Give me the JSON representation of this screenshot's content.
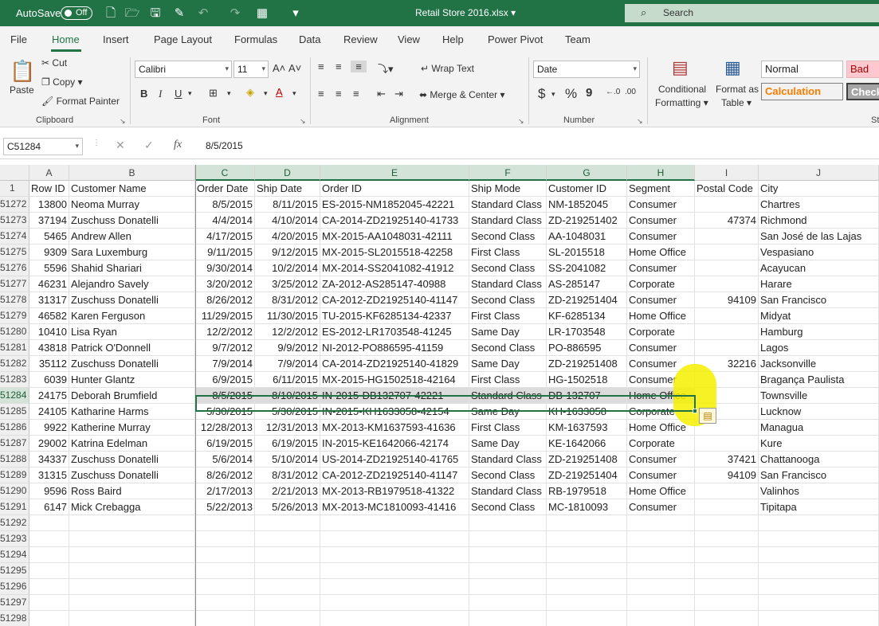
{
  "titlebar": {
    "autosave_label": "AutoSave",
    "autosave_state": "Off",
    "title": "Retail Store 2016.xlsx",
    "search_placeholder": "Search"
  },
  "tabs": [
    "File",
    "Home",
    "Insert",
    "Page Layout",
    "Formulas",
    "Data",
    "Review",
    "View",
    "Help",
    "Power Pivot",
    "Team"
  ],
  "active_tab": "Home",
  "ribbon": {
    "clipboard": {
      "label": "Clipboard",
      "paste": "Paste",
      "cut": "Cut",
      "copy": "Copy",
      "format_painter": "Format Painter"
    },
    "font": {
      "label": "Font",
      "name": "Calibri",
      "size": "11",
      "bold": "B",
      "italic": "I",
      "underline": "U"
    },
    "alignment": {
      "label": "Alignment",
      "wrap_text": "Wrap Text",
      "merge_center": "Merge & Center"
    },
    "number": {
      "label": "Number",
      "format": "Date",
      "currency": "$",
      "percent": "%",
      "comma": "9"
    },
    "styles": {
      "conditional_formatting_1": "Conditional",
      "conditional_formatting_2": "Formatting",
      "format_as_table_1": "Format as",
      "format_as_table_2": "Table",
      "normal": "Normal",
      "bad": "Bad",
      "calculation": "Calculation",
      "check": "Check",
      "group_label_partial": "St"
    }
  },
  "formula_bar": {
    "name_box": "C51284",
    "value": "8/5/2015"
  },
  "columns": [
    "A",
    "B",
    "C",
    "D",
    "E",
    "F",
    "G",
    "H",
    "I",
    "J"
  ],
  "header_row": {
    "row_number": "1",
    "cells": [
      "Row ID",
      "Customer Name",
      "Order Date",
      "Ship Date",
      "Order ID",
      "Ship Mode",
      "Customer ID",
      "Segment",
      "Postal Code",
      "City"
    ]
  },
  "rows": [
    {
      "n": "51272",
      "c": [
        "13800",
        "Neoma Murray",
        "8/5/2015",
        "8/11/2015",
        "ES-2015-NM1852045-42221",
        "Standard Class",
        "NM-1852045",
        "Consumer",
        "",
        "Chartres"
      ]
    },
    {
      "n": "51273",
      "c": [
        "37194",
        "Zuschuss Donatelli",
        "4/4/2014",
        "4/10/2014",
        "CA-2014-ZD21925140-41733",
        "Standard Class",
        "ZD-219251402",
        "Consumer",
        "47374",
        "Richmond"
      ]
    },
    {
      "n": "51274",
      "c": [
        "5465",
        "Andrew Allen",
        "4/17/2015",
        "4/20/2015",
        "MX-2015-AA1048031-42111",
        "Second Class",
        "AA-1048031",
        "Consumer",
        "",
        "San José de las Lajas"
      ]
    },
    {
      "n": "51275",
      "c": [
        "9309",
        "Sara Luxemburg",
        "9/11/2015",
        "9/12/2015",
        "MX-2015-SL2015518-42258",
        "First Class",
        "SL-2015518",
        "Home Office",
        "",
        "Vespasiano"
      ]
    },
    {
      "n": "51276",
      "c": [
        "5596",
        "Shahid Shariari",
        "9/30/2014",
        "10/2/2014",
        "MX-2014-SS2041082-41912",
        "Second Class",
        "SS-2041082",
        "Consumer",
        "",
        "Acayucan"
      ]
    },
    {
      "n": "51277",
      "c": [
        "46231",
        "Alejandro Savely",
        "3/20/2012",
        "3/25/2012",
        "ZA-2012-AS285147-40988",
        "Standard Class",
        "AS-285147",
        "Corporate",
        "",
        "Harare"
      ]
    },
    {
      "n": "51278",
      "c": [
        "31317",
        "Zuschuss Donatelli",
        "8/26/2012",
        "8/31/2012",
        "CA-2012-ZD21925140-41147",
        "Second Class",
        "ZD-219251404",
        "Consumer",
        "94109",
        "San Francisco"
      ]
    },
    {
      "n": "51279",
      "c": [
        "46582",
        "Karen Ferguson",
        "11/29/2015",
        "11/30/2015",
        "TU-2015-KF6285134-42337",
        "First Class",
        "KF-6285134",
        "Home Office",
        "",
        "Midyat"
      ]
    },
    {
      "n": "51280",
      "c": [
        "10410",
        "Lisa Ryan",
        "12/2/2012",
        "12/2/2012",
        "ES-2012-LR1703548-41245",
        "Same Day",
        "LR-1703548",
        "Corporate",
        "",
        "Hamburg"
      ]
    },
    {
      "n": "51281",
      "c": [
        "43818",
        "Patrick O'Donnell",
        "9/7/2012",
        "9/9/2012",
        "NI-2012-PO886595-41159",
        "Second Class",
        "PO-886595",
        "Consumer",
        "",
        "Lagos"
      ]
    },
    {
      "n": "51282",
      "c": [
        "35112",
        "Zuschuss Donatelli",
        "7/9/2014",
        "7/9/2014",
        "CA-2014-ZD21925140-41829",
        "Same Day",
        "ZD-219251408",
        "Consumer",
        "32216",
        "Jacksonville"
      ]
    },
    {
      "n": "51283",
      "c": [
        "6039",
        "Hunter Glantz",
        "6/9/2015",
        "6/11/2015",
        "MX-2015-HG1502518-42164",
        "First Class",
        "HG-1502518",
        "Consumer",
        "",
        "Bragança Paulista"
      ]
    },
    {
      "n": "51284",
      "c": [
        "24175",
        "Deborah Brumfield",
        "8/5/2015",
        "8/10/2015",
        "IN-2015-DB132707-42221",
        "Standard Class",
        "DB-132707",
        "Home Office",
        "",
        "Townsville"
      ],
      "selected": true
    },
    {
      "n": "51285",
      "c": [
        "24105",
        "Katharine Harms",
        "5/30/2015",
        "5/30/2015",
        "IN-2015-KH1633058-42154",
        "Same Day",
        "KH-1633058",
        "Corporate",
        "",
        "Lucknow"
      ]
    },
    {
      "n": "51286",
      "c": [
        "9922",
        "Katherine Murray",
        "12/28/2013",
        "12/31/2013",
        "MX-2013-KM1637593-41636",
        "First Class",
        "KM-1637593",
        "Home Office",
        "",
        "Managua"
      ]
    },
    {
      "n": "51287",
      "c": [
        "29002",
        "Katrina Edelman",
        "6/19/2015",
        "6/19/2015",
        "IN-2015-KE1642066-42174",
        "Same Day",
        "KE-1642066",
        "Corporate",
        "",
        "Kure"
      ]
    },
    {
      "n": "51288",
      "c": [
        "34337",
        "Zuschuss Donatelli",
        "5/6/2014",
        "5/10/2014",
        "US-2014-ZD21925140-41765",
        "Standard Class",
        "ZD-219251408",
        "Consumer",
        "37421",
        "Chattanooga"
      ]
    },
    {
      "n": "51289",
      "c": [
        "31315",
        "Zuschuss Donatelli",
        "8/26/2012",
        "8/31/2012",
        "CA-2012-ZD21925140-41147",
        "Second Class",
        "ZD-219251404",
        "Consumer",
        "94109",
        "San Francisco"
      ]
    },
    {
      "n": "51290",
      "c": [
        "9596",
        "Ross Baird",
        "2/17/2013",
        "2/21/2013",
        "MX-2013-RB1979518-41322",
        "Standard Class",
        "RB-1979518",
        "Home Office",
        "",
        "Valinhos"
      ]
    },
    {
      "n": "51291",
      "c": [
        "6147",
        "Mick Crebagga",
        "5/22/2013",
        "5/26/2013",
        "MX-2013-MC1810093-41416",
        "Second Class",
        "MC-1810093",
        "Consumer",
        "",
        "Tipitapa"
      ]
    },
    {
      "n": "51292",
      "c": [
        "",
        "",
        "",
        "",
        "",
        "",
        "",
        "",
        "",
        ""
      ]
    },
    {
      "n": "51293",
      "c": [
        "",
        "",
        "",
        "",
        "",
        "",
        "",
        "",
        "",
        ""
      ]
    },
    {
      "n": "51294",
      "c": [
        "",
        "",
        "",
        "",
        "",
        "",
        "",
        "",
        "",
        ""
      ]
    },
    {
      "n": "51295",
      "c": [
        "",
        "",
        "",
        "",
        "",
        "",
        "",
        "",
        "",
        ""
      ]
    },
    {
      "n": "51296",
      "c": [
        "",
        "",
        "",
        "",
        "",
        "",
        "",
        "",
        "",
        ""
      ]
    },
    {
      "n": "51297",
      "c": [
        "",
        "",
        "",
        "",
        "",
        "",
        "",
        "",
        "",
        ""
      ]
    },
    {
      "n": "51298",
      "c": [
        "",
        "",
        "",
        "",
        "",
        "",
        "",
        "",
        "",
        ""
      ]
    }
  ],
  "colors": {
    "accent": "#217346",
    "highlight": "#f5f000"
  }
}
